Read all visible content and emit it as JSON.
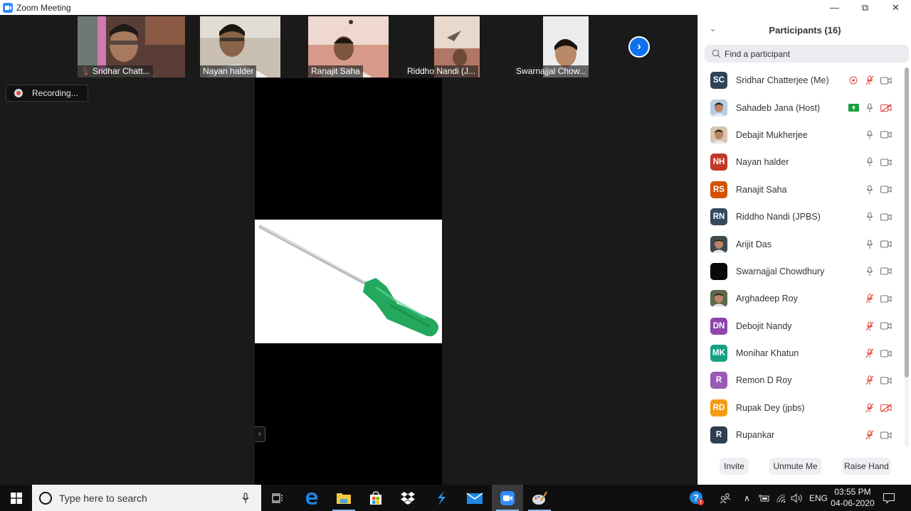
{
  "window": {
    "title": "Zoom Meeting",
    "controls": {
      "minimize": "—",
      "restore": "⧉",
      "close": "✕"
    }
  },
  "video_strip": {
    "tiles": [
      {
        "name": "Sridhar Chatt...",
        "muted": true
      },
      {
        "name": "Nayan halder",
        "muted": false
      },
      {
        "name": "Ranajit  Saha",
        "muted": false
      },
      {
        "name": "Riddho Nandi (J...",
        "muted": false
      },
      {
        "name": "Swarnajjal Chow...",
        "muted": false
      }
    ],
    "next_icon": "›"
  },
  "recording": {
    "label": "Recording..."
  },
  "share": {
    "content": "screwdriver image",
    "side_toggle_icon": "›"
  },
  "participants_panel": {
    "title": "Participants (16)",
    "collapse_icon": "⌄",
    "search_placeholder": "Find a participant",
    "participants": [
      {
        "name": "Sridhar Chatterjee (Me)",
        "initials": "SC",
        "avatar_color": "#2f4459",
        "avatar_type": "initials",
        "recording": true,
        "mic": "muted",
        "video": "on"
      },
      {
        "name": "Sahadeb Jana (Host)",
        "initials": "",
        "avatar_color": "#b7cde3",
        "avatar_type": "photo",
        "sharing": true,
        "mic": "on",
        "video": "off"
      },
      {
        "name": "Debajit Mukherjee",
        "initials": "",
        "avatar_color": "#d8c3ad",
        "avatar_type": "photo",
        "mic": "on",
        "video": "on"
      },
      {
        "name": "Nayan halder",
        "initials": "NH",
        "avatar_color": "#c0392b",
        "avatar_type": "initials",
        "mic": "on",
        "video": "on"
      },
      {
        "name": "Ranajit  Saha",
        "initials": "RS",
        "avatar_color": "#d35400",
        "avatar_type": "initials",
        "mic": "on",
        "video": "on"
      },
      {
        "name": "Riddho Nandi (JPBS)",
        "initials": "RN",
        "avatar_color": "#34495e",
        "avatar_type": "initials",
        "mic": "on",
        "video": "on"
      },
      {
        "name": "Arijit Das",
        "initials": "",
        "avatar_color": "#3c4a52",
        "avatar_type": "photo",
        "mic": "on",
        "video": "on"
      },
      {
        "name": "Swarnajjal Chowdhury",
        "initials": "",
        "avatar_color": "#0a0a0a",
        "avatar_type": "photo",
        "mic": "on",
        "video": "on"
      },
      {
        "name": "Arghadeep Roy",
        "initials": "",
        "avatar_color": "#5a6b4a",
        "avatar_type": "photo",
        "mic": "muted",
        "video": "on"
      },
      {
        "name": "Debojit Nandy",
        "initials": "DN",
        "avatar_color": "#8e44ad",
        "avatar_type": "initials",
        "mic": "muted",
        "video": "on"
      },
      {
        "name": "Monihar Khatun",
        "initials": "MK",
        "avatar_color": "#16a085",
        "avatar_type": "initials",
        "mic": "muted",
        "video": "on"
      },
      {
        "name": "Remon D Roy",
        "initials": "R",
        "avatar_color": "#9b59b6",
        "avatar_type": "initials",
        "mic": "muted",
        "video": "on"
      },
      {
        "name": "Rupak Dey (jpbs)",
        "initials": "RD",
        "avatar_color": "#f39c12",
        "avatar_type": "initials",
        "mic": "muted",
        "video": "off"
      },
      {
        "name": "Rupankar",
        "initials": "R",
        "avatar_color": "#2c3e50",
        "avatar_type": "initials",
        "mic": "muted",
        "video": "on"
      }
    ],
    "buttons": {
      "invite": "Invite",
      "unmute": "Unmute Me",
      "raise_hand": "Raise Hand"
    }
  },
  "taskbar": {
    "search_placeholder": "Type here to search",
    "apps": [
      "task-view",
      "edge",
      "file-explorer",
      "microsoft-store",
      "dropbox",
      "app-arrow",
      "mail",
      "zoom",
      "paint"
    ],
    "active_app": "zoom",
    "tray": {
      "language": "ENG",
      "time": "03:55 PM",
      "date": "04-06-2020"
    }
  },
  "colors": {
    "accent": "#0e72ed",
    "muted_red": "#e0483e",
    "share_green": "#1a9e3f"
  }
}
